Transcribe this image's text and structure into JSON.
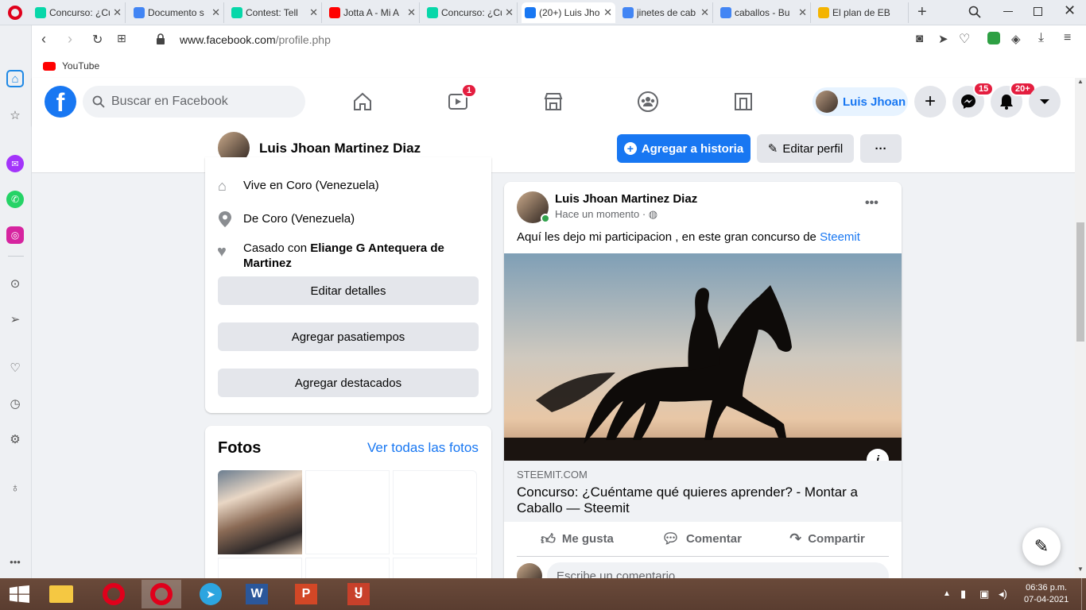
{
  "tabs": [
    {
      "label": "Concurso: ¿Cu",
      "icon": "steemit-icon",
      "color": "#07d7a9"
    },
    {
      "label": "Documento s",
      "icon": "docs-icon",
      "color": "#4285f4"
    },
    {
      "label": "Contest: Tell",
      "icon": "steemit-icon",
      "color": "#07d7a9"
    },
    {
      "label": "Jotta A - Mi A",
      "icon": "youtube-icon",
      "color": "#ff0000"
    },
    {
      "label": "Concurso: ¿Cu",
      "icon": "steemit-icon",
      "color": "#07d7a9"
    },
    {
      "label": "(20+) Luis Jho",
      "icon": "facebook-icon",
      "color": "#1877f2"
    },
    {
      "label": "jinetes de cab",
      "icon": "google-icon",
      "color": "#4285f4"
    },
    {
      "label": "caballos - Bu",
      "icon": "google-icon",
      "color": "#4285f4"
    },
    {
      "label": "El plan de EB",
      "icon": "slides-icon",
      "color": "#f4b400"
    }
  ],
  "address": {
    "domain": "www.facebook.com",
    "path": "/profile.php"
  },
  "bookmarks": [
    {
      "label": "YouTube"
    }
  ],
  "fb": {
    "search_placeholder": "Buscar en Facebook",
    "watch_badge": "1",
    "user_short": "Luis Jhoan",
    "messenger_badge": "15",
    "notif_badge": "20+",
    "profile_name": "Luis Jhoan Martinez Diaz",
    "add_story": "Agregar a historia",
    "edit_profile": "Editar perfil",
    "more": "···"
  },
  "intro": {
    "lives_prefix": "Vive en ",
    "lives_place": "Coro (Venezuela)",
    "from_prefix": "De ",
    "from_place": "Coro (Venezuela)",
    "married_prefix": "Casado con ",
    "married_name": "Eliange G Antequera de Martinez",
    "edit_details": "Editar detalles",
    "add_hobbies": "Agregar pasatiempos",
    "add_featured": "Agregar destacados"
  },
  "photos": {
    "title": "Fotos",
    "see_all": "Ver todas las fotos"
  },
  "post": {
    "author": "Luis Jhoan Martinez Diaz",
    "time": "Hace un momento · ",
    "text_prefix": "Aquí les dejo mi participacion , en este gran concurso de ",
    "text_link": "Steemit",
    "link_domain": "STEEMIT.COM",
    "link_title": "Concurso: ¿Cuéntame qué quieres aprender? - Montar a Caballo — Steemit",
    "like": "Me gusta",
    "comment": "Comentar",
    "share": "Compartir",
    "comment_placeholder": "Escribe un comentario..."
  },
  "taskbar": {
    "time": "06:36 p.m.",
    "date": "07-04-2021"
  },
  "colors": {
    "fb_blue": "#1877f2",
    "badge_red": "#e41e3f",
    "opera_red": "#e0001b"
  }
}
